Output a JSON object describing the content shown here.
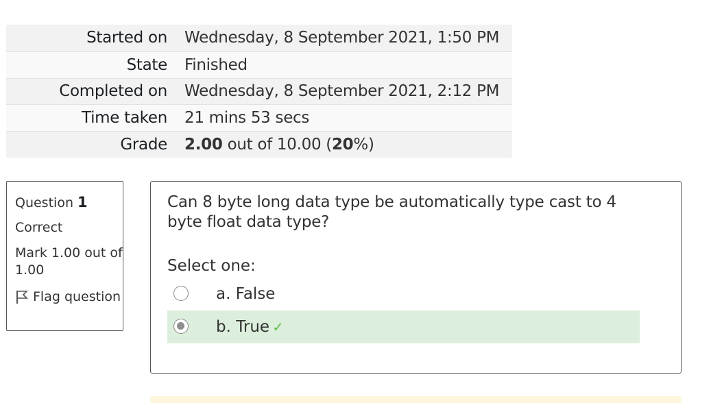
{
  "summary": {
    "rows": [
      {
        "label": "Started on",
        "value": "Wednesday, 8 September 2021, 1:50 PM"
      },
      {
        "label": "State",
        "value": "Finished"
      },
      {
        "label": "Completed on",
        "value": "Wednesday, 8 September 2021, 2:12 PM"
      },
      {
        "label": "Time taken",
        "value": "21 mins 53 secs"
      },
      {
        "label": "Grade",
        "value_bold": "2.00",
        "value_mid": " out of 10.00 (",
        "value_pct": "20",
        "value_end": "%)"
      }
    ]
  },
  "question": {
    "label": "Question",
    "number": "1",
    "state": "Correct",
    "grade": "Mark 1.00 out of 1.00",
    "flag": "Flag question",
    "text": "Can 8 byte long data type be automatically type cast to 4 byte float data type?",
    "prompt": "Select one:",
    "options": [
      {
        "label": "a. False",
        "selected": false,
        "correct": false
      },
      {
        "label": "b. True",
        "selected": true,
        "correct": true
      }
    ],
    "correct_mark": "✓"
  },
  "colors": {
    "correct_bg": "#dcefdc",
    "check": "#5fbf4a"
  }
}
